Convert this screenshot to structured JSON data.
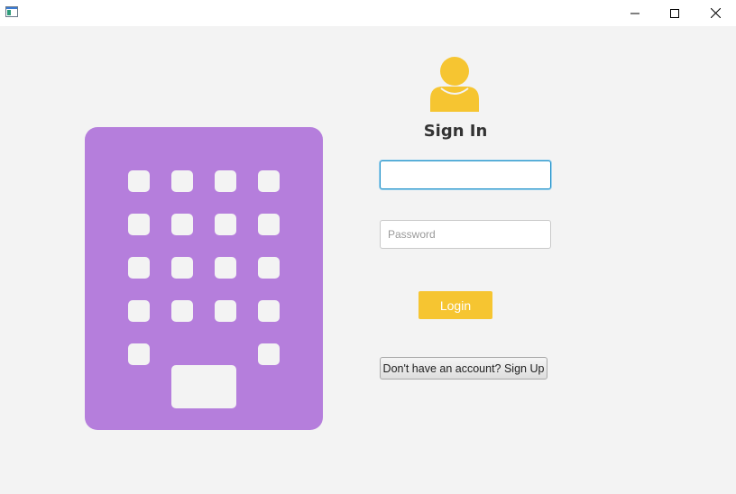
{
  "window": {
    "icon": "app-window-icon",
    "controls": {
      "minimize": "minimize-icon",
      "maximize": "maximize-icon",
      "close": "close-icon"
    }
  },
  "illustration": {
    "icon": "building-icon",
    "color": "#b57edc",
    "window_color": "#f3f3f3"
  },
  "login": {
    "avatar_icon": "user-icon",
    "avatar_color": "#f6c531",
    "title": "Sign In",
    "username_value": "",
    "password_placeholder": "Password",
    "login_label": "Login",
    "login_color": "#f6c531",
    "signup_label": "Don't have an account? Sign Up"
  }
}
